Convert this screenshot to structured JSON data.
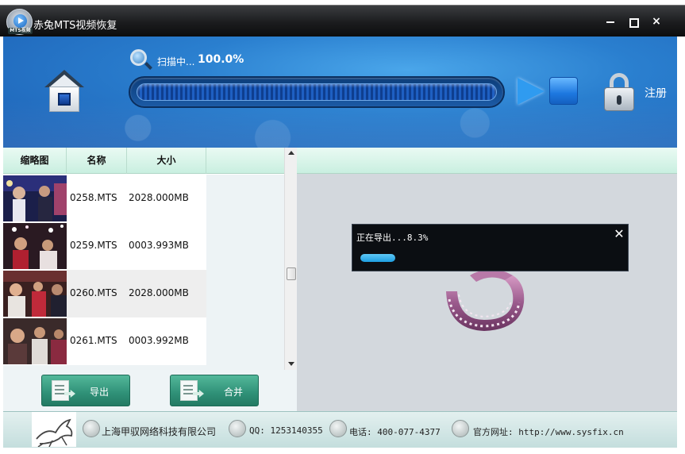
{
  "window": {
    "title": "赤兔MTS视频恢复",
    "logo_text": "MTS视频",
    "close_glyph": "×"
  },
  "scan": {
    "status_text": "扫描中...",
    "percent_text": "100.0%",
    "progress": 1.0
  },
  "header": {
    "register_label": "注册"
  },
  "table": {
    "columns": [
      "缩略图",
      "名称",
      "大小"
    ],
    "rows": [
      {
        "name": "0258.MTS",
        "size": "2028.000MB",
        "selected": false
      },
      {
        "name": "0259.MTS",
        "size": "0003.993MB",
        "selected": false
      },
      {
        "name": "0260.MTS",
        "size": "2028.000MB",
        "selected": true
      },
      {
        "name": "0261.MTS",
        "size": "0003.992MB",
        "selected": false
      }
    ]
  },
  "actions": {
    "export_label": "导出",
    "merge_label": "合并"
  },
  "dialog": {
    "message": "正在导出...8.3%",
    "close_glyph": "✕",
    "progress": 0.083
  },
  "footer": {
    "company": "上海甲驭网络科技有限公司",
    "qq": "QQ: 1253140355",
    "phone": "电话: 400-077-4377",
    "website": "官方网址: http://www.sysfix.cn"
  },
  "colors": {
    "header_blue": "#2a7fcf",
    "action_green": "#2f9077",
    "dialog_bg": "#0b0e12",
    "dialog_progress": "#1e9ee0"
  }
}
